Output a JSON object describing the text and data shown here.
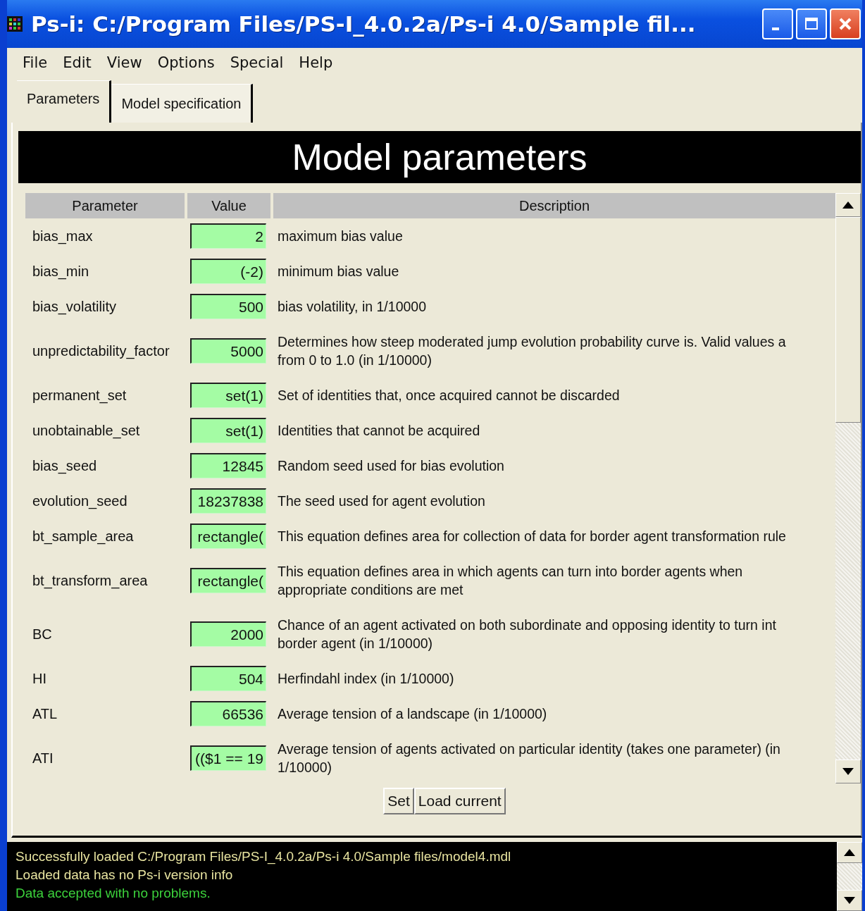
{
  "window": {
    "title": "Ps-i: C:/Program Files/PS-I_4.0.2a/Ps-i 4.0/Sample fil..."
  },
  "menu": [
    "File",
    "Edit",
    "View",
    "Options",
    "Special",
    "Help"
  ],
  "tabs": [
    {
      "label": "Parameters",
      "selected": true
    },
    {
      "label": "Model specification",
      "selected": false
    }
  ],
  "panel_title": "Model parameters",
  "table": {
    "columns": [
      "Parameter",
      "Value",
      "Description"
    ],
    "rows": [
      {
        "parameter": "bias_max",
        "value": "2",
        "description": "maximum bias value"
      },
      {
        "parameter": "bias_min",
        "value": "(-2)",
        "description": "minimum bias value"
      },
      {
        "parameter": "bias_volatility",
        "value": "500",
        "description": "bias volatility, in 1/10000"
      },
      {
        "parameter": "unpredictability_factor",
        "value": "5000",
        "description": "Determines how steep moderated jump evolution probability curve is. Valid values a",
        "description_2": "from 0 to 1.0 (in 1/10000)"
      },
      {
        "parameter": "permanent_set",
        "value": "set(1)",
        "description": "Set of identities that, once acquired cannot be discarded"
      },
      {
        "parameter": "unobtainable_set",
        "value": "set(1)",
        "description": "Identities that cannot be acquired"
      },
      {
        "parameter": "bias_seed",
        "value": "12845",
        "description": "Random seed used for bias evolution"
      },
      {
        "parameter": "evolution_seed",
        "value": "18237838",
        "description": "The seed used for agent evolution"
      },
      {
        "parameter": "bt_sample_area",
        "value": "rectangle(",
        "description": "This equation defines area for collection of data for border agent transformation rule"
      },
      {
        "parameter": "bt_transform_area",
        "value": "rectangle(",
        "description": "This equation defines area in which agents can turn into border agents when",
        "description_2": "appropriate conditions are met"
      },
      {
        "parameter": "BC",
        "value": "2000",
        "description": "Chance of an agent activated on both subordinate and opposing identity to turn int",
        "description_2": "border agent (in 1/10000)"
      },
      {
        "parameter": "HI",
        "value": "504",
        "description": "Herfindahl index (in 1/10000)"
      },
      {
        "parameter": "ATL",
        "value": "66536",
        "description": "Average tension of a landscape (in 1/10000)"
      },
      {
        "parameter": "ATI",
        "value": "(($1 == 19",
        "description": "Average tension of agents activated on particular identity (takes one parameter) (in",
        "description_2": "1/10000)"
      }
    ]
  },
  "buttons": [
    "Set",
    "Load current"
  ],
  "log": [
    {
      "text": "Successfully loaded C:/Program Files/PS-I_4.0.2a/Ps-i 4.0/Sample files/model4.mdl",
      "color": "#e8e4a0"
    },
    {
      "text": "Loaded data has no Ps-i version info",
      "color": "#e8e4a0"
    },
    {
      "text": "Data accepted with no problems.",
      "color": "#3cd23c"
    }
  ]
}
